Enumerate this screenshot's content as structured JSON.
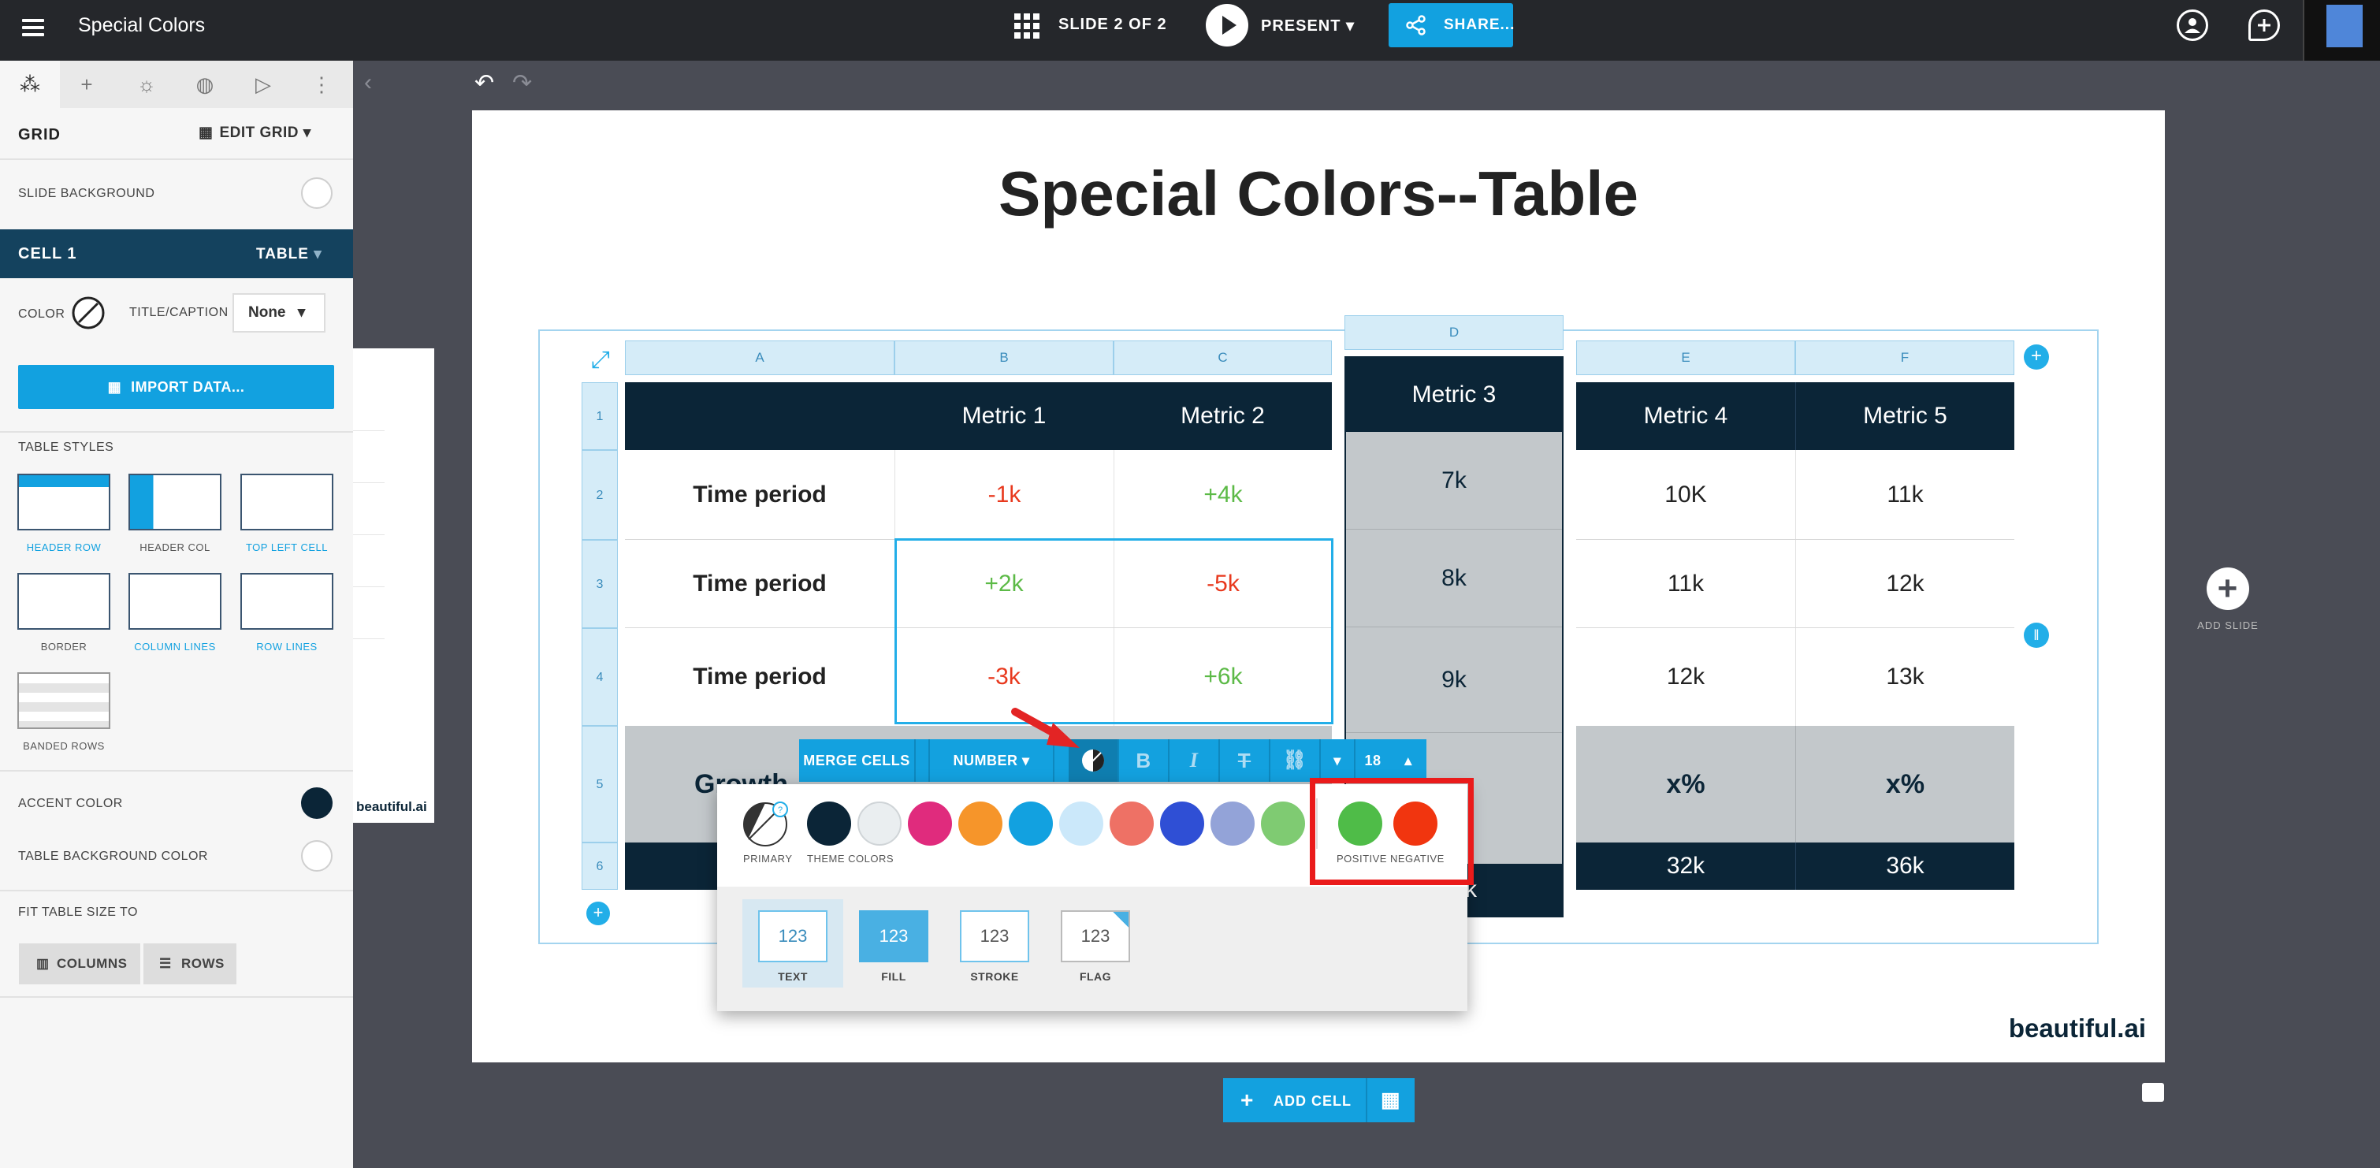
{
  "app": {
    "title": "Special Colors",
    "slide_counter": "SLIDE 2 OF 2",
    "present_label": "PRESENT",
    "share_label": "SHARE..."
  },
  "sidebar": {
    "grid_label": "GRID",
    "edit_grid_label": "EDIT GRID",
    "slide_background_label": "SLIDE BACKGROUND",
    "cell_label": "CELL 1",
    "cell_type": "TABLE",
    "color_label": "COLOR",
    "title_caption_label": "TITLE/CAPTION",
    "title_caption_value": "None",
    "import_label": "IMPORT DATA...",
    "table_styles_label": "TABLE STYLES",
    "styles": [
      "HEADER ROW",
      "HEADER COL",
      "TOP LEFT CELL",
      "BORDER",
      "COLUMN LINES",
      "ROW LINES",
      "BANDED ROWS"
    ],
    "accent_color_label": "ACCENT COLOR",
    "accent_color": "#0b2537",
    "table_bg_label": "TABLE BACKGROUND COLOR",
    "fit_label": "FIT TABLE SIZE TO",
    "columns_label": "COLUMNS",
    "rows_label": "ROWS"
  },
  "thumb": {
    "brand": "beautiful.ai"
  },
  "slide": {
    "title": "Special Colors--Table",
    "brand": "beautiful.ai",
    "column_letters": [
      "A",
      "B",
      "C",
      "D",
      "E",
      "F"
    ],
    "row_numbers": [
      "1",
      "2",
      "3",
      "4",
      "5",
      "6"
    ],
    "headers": [
      "Metric 1",
      "Metric 2",
      "Metric 3",
      "Metric 4",
      "Metric 5"
    ],
    "rows": [
      {
        "label": "Time period",
        "values": [
          "-1k",
          "+4k",
          "7k",
          "10K",
          "11k"
        ]
      },
      {
        "label": "Time period",
        "values": [
          "+2k",
          "-5k",
          "8k",
          "11k",
          "12k"
        ]
      },
      {
        "label": "Time period",
        "values": [
          "-3k",
          "+6k",
          "9k",
          "12k",
          "13k"
        ]
      },
      {
        "label": "Growth",
        "values": [
          "",
          "",
          "",
          "x%",
          "x%"
        ]
      },
      {
        "label": "",
        "values": [
          "",
          "",
          "k",
          "32k",
          "36k"
        ]
      }
    ]
  },
  "toolbar": {
    "merge_label": "MERGE CELLS",
    "number_label": "NUMBER",
    "font_size": "18"
  },
  "color_popup": {
    "primary_label": "PRIMARY",
    "theme_label": "THEME COLORS",
    "positive_label": "POSITIVE",
    "negative_label": "NEGATIVE",
    "swatches": [
      "#0b2537",
      "#eaeef0",
      "#e02b7d",
      "#f6952a",
      "#12a1e0",
      "#cbe8fa",
      "#ee7165",
      "#2f4fd5",
      "#93a3d8",
      "#7fcb72"
    ],
    "positive_color": "#4fbc48",
    "negative_color": "#f1350f",
    "modes": [
      "TEXT",
      "FILL",
      "STROKE",
      "FLAG"
    ],
    "mode_sample": "123"
  },
  "bottom": {
    "add_cell_label": "ADD CELL",
    "add_slide_label": "ADD SLIDE"
  }
}
